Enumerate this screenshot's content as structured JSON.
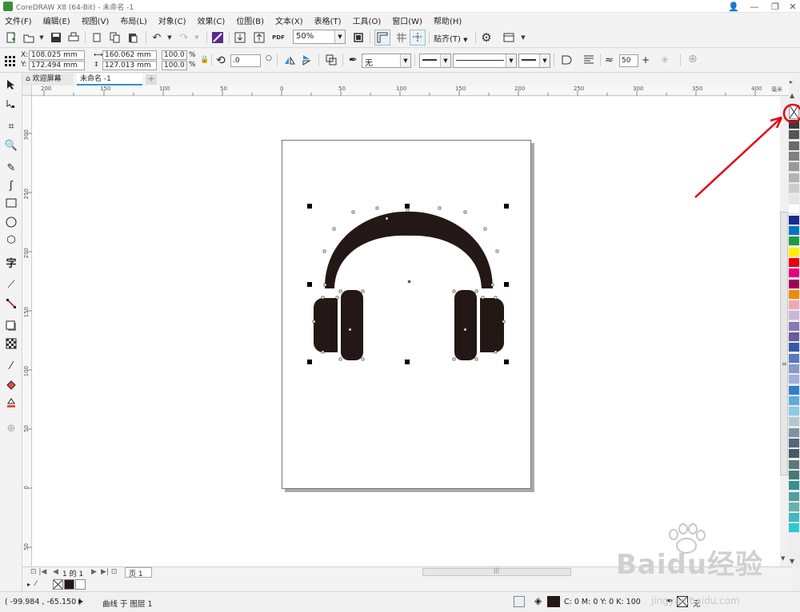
{
  "window": {
    "title": "CoreDRAW X8 (64-Bit) - 未命名 -1",
    "controls": [
      "👤",
      "—",
      "❐",
      "✕"
    ]
  },
  "menu": [
    "文件(F)",
    "编辑(E)",
    "视图(V)",
    "布局(L)",
    "对象(C)",
    "效果(C)",
    "位图(B)",
    "文本(X)",
    "表格(T)",
    "工具(O)",
    "窗口(W)",
    "帮助(H)"
  ],
  "toolbar": {
    "zoom": "50%",
    "snap_label": "贴齐(T)",
    "pdf_label": "PDF"
  },
  "properties": {
    "x": "108.025 mm",
    "y": "172.494 mm",
    "width": "160.062 mm",
    "height": "127.013 mm",
    "scale_w": "100.0",
    "scale_h": "100.0",
    "percent": "%",
    "rotation": ".0",
    "fill_none": "无",
    "smooth": "50",
    "x_label": "X:",
    "y_label": "Y:"
  },
  "tabs": {
    "welcome": "欢迎屏幕",
    "document": "未命名 -1",
    "add": "+"
  },
  "ruler": {
    "h_ticks": [
      "200",
      "150",
      "100",
      "50",
      "0",
      "50",
      "100",
      "150",
      "200",
      "250",
      "300",
      "350",
      "400"
    ],
    "h_unit": "毫米",
    "v_ticks": [
      "300",
      "250",
      "200",
      "150",
      "100",
      "50",
      "0",
      "50"
    ]
  },
  "page_nav": {
    "counter": "1 的 1",
    "page_tab": "页 1"
  },
  "palette_colors": [
    "#3a3a3a",
    "#555555",
    "#6b6b6b",
    "#808080",
    "#999999",
    "#b3b3b3",
    "#cccccc",
    "#e6e6e6",
    "#ffffff",
    "#1a2b8c",
    "#0075c2",
    "#1e9a46",
    "#ffee00",
    "#e60012",
    "#e6007e",
    "#a4005b",
    "#f08c00",
    "#f0a8b0",
    "#c8b8d8",
    "#8878b8",
    "#6a5aa0",
    "#3858a8",
    "#5878c0",
    "#8898c8",
    "#a0b0d8",
    "#3080c8",
    "#60a8e0",
    "#90c8e8",
    "#b0c8d0",
    "#8090a0",
    "#506878",
    "#485868",
    "#607878",
    "#487878",
    "#389090",
    "#50a0a0",
    "#68b0b0",
    "#40b8c0",
    "#30c8d0"
  ],
  "status": {
    "coords": "( -99.984 , -65.150 )",
    "object_info": "曲线 于 图层 1",
    "fill_info": "C: 0 M: 0 Y: 0 K: 100",
    "outline_info": "无"
  },
  "watermark": {
    "brand": "Baidu经验",
    "url": "jingyan.baidu.com"
  },
  "colors": {
    "accent": "#2d8fd8",
    "artwork": "#231815",
    "annotation": "#e60012"
  }
}
